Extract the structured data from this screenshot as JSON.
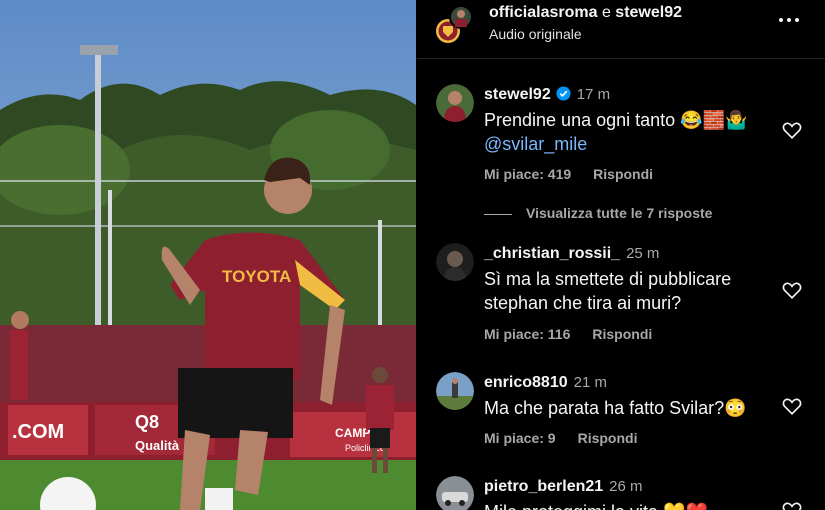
{
  "header": {
    "user1": "officialasroma",
    "separator": "e",
    "user2": "stewel92",
    "audio": "Audio originale"
  },
  "media": {
    "jersey_text": "TOYOTA",
    "board_text_left": ".COM",
    "board_text_mid": "Q8",
    "board_text_mid2": "Qualità",
    "board_text_right": "CAMPU",
    "board_text_right2": "Policlinico"
  },
  "comments": [
    {
      "username": "stewel92",
      "verified": true,
      "time": "17 m",
      "text": "Prendine una ogni tanto 😂🧱🤷‍♂️",
      "mention": "@svilar_mile",
      "likes": "Mi piace: 419",
      "reply": "Rispondi"
    },
    {
      "username": "_christian_rossii_",
      "time": "25 m",
      "text": "Sì ma la smettete di pubblicare stephan che tira ai muri?",
      "likes": "Mi piace: 116",
      "reply": "Rispondi"
    },
    {
      "username": "enrico8810",
      "time": "21 m",
      "text": "Ma che parata ha fatto Svilar?😳",
      "likes": "Mi piace: 9",
      "reply": "Rispondi"
    },
    {
      "username": "pietro_berlen21",
      "time": "26 m",
      "text": "Mile proteggimi la vita 💛❤️"
    }
  ],
  "view_replies": "Visualizza tutte le 7 risposte",
  "colors": {
    "background": "#000000",
    "text": "#f5f5f5",
    "secondary": "#a8a8a8",
    "mention": "#79b8ff",
    "verified": "#0095f6",
    "roma_red": "#8e1f2f",
    "roma_gold": "#f0bc42"
  },
  "icons": [
    "more-icon",
    "heart-icon",
    "verified-icon"
  ]
}
